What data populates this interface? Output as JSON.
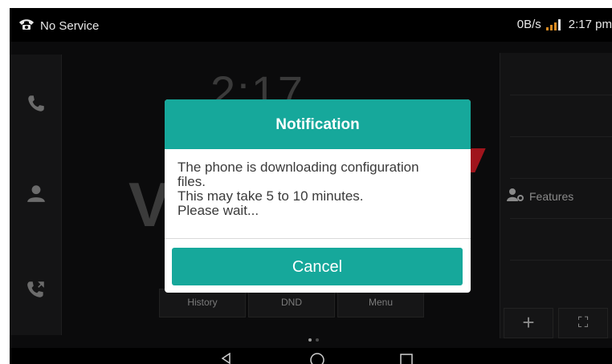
{
  "status_bar": {
    "carrier": "No Service",
    "network_speed": "0B/s",
    "time": "2:17 pm",
    "icons": [
      "phone-icon",
      "signal-icon"
    ]
  },
  "home": {
    "clock": "2:17",
    "left_icons": [
      "phone-handset-icon",
      "contacts-icon",
      "call-transfer-icon"
    ],
    "softkeys": [
      "History",
      "DND",
      "Menu"
    ],
    "right_panel": {
      "features_label": "Features",
      "buttons": [
        "+",
        "⛶"
      ]
    }
  },
  "dialog": {
    "title": "Notification",
    "message_lines": [
      "The phone is downloading configuration",
      "files.",
      "This may take 5 to 10 minutes.",
      "Please wait..."
    ],
    "cancel_label": "Cancel",
    "accent": "#16a89b"
  },
  "nav_bar": {
    "icons": [
      "back-icon",
      "home-icon",
      "recents-icon"
    ]
  }
}
